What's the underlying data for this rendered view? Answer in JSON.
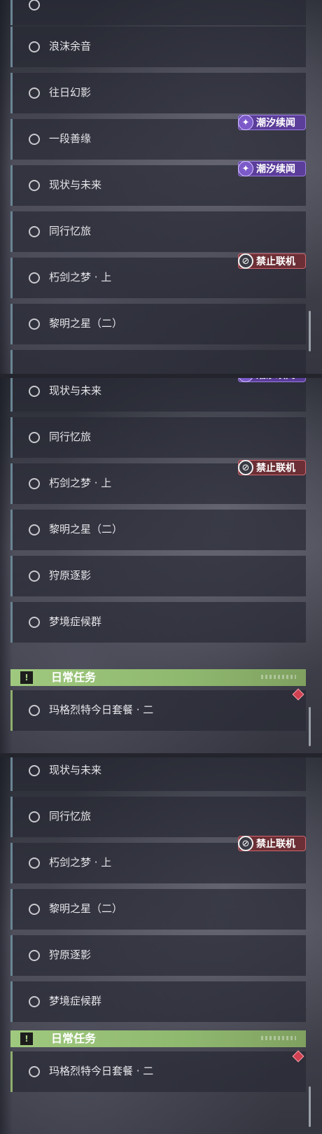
{
  "colors": {
    "tide_badge_bg": "#5b3d9a",
    "noonline_badge_bg": "#6b2f35",
    "daily_header_bg": "#9fc97e",
    "row_accent": "#6a8494",
    "daily_accent": "#8fae6c",
    "daily_marker": "#d04050"
  },
  "badges": {
    "tide": {
      "label": "潮汐续闻",
      "icon": "tide-wave-icon"
    },
    "no_online": {
      "label": "禁止联机",
      "icon": "no-online-icon"
    }
  },
  "panels": [
    {
      "quests": [
        {
          "label": "浪沫余音"
        },
        {
          "label": "往日幻影"
        },
        {
          "label": "一段善缘"
        },
        {
          "label": "现状与未来"
        },
        {
          "label": "同行忆旅"
        },
        {
          "label": "朽剑之梦 · 上"
        },
        {
          "label": "黎明之星（二）"
        }
      ]
    },
    {
      "quests": [
        {
          "label": "现状与未来"
        },
        {
          "label": "同行忆旅"
        },
        {
          "label": "朽剑之梦 · 上"
        },
        {
          "label": "黎明之星（二）"
        },
        {
          "label": "狩原逐影"
        },
        {
          "label": "梦境症候群"
        }
      ],
      "daily_section": {
        "title": "日常任务",
        "quests": [
          {
            "label": "玛格烈特今日套餐 · 二"
          }
        ]
      }
    },
    {
      "quests": [
        {
          "label": "现状与未来"
        },
        {
          "label": "同行忆旅"
        },
        {
          "label": "朽剑之梦 · 上"
        },
        {
          "label": "黎明之星（二）"
        },
        {
          "label": "狩原逐影"
        },
        {
          "label": "梦境症候群"
        }
      ],
      "daily_section": {
        "title": "日常任务",
        "quests": [
          {
            "label": "玛格烈特今日套餐 · 二"
          }
        ]
      }
    }
  ]
}
